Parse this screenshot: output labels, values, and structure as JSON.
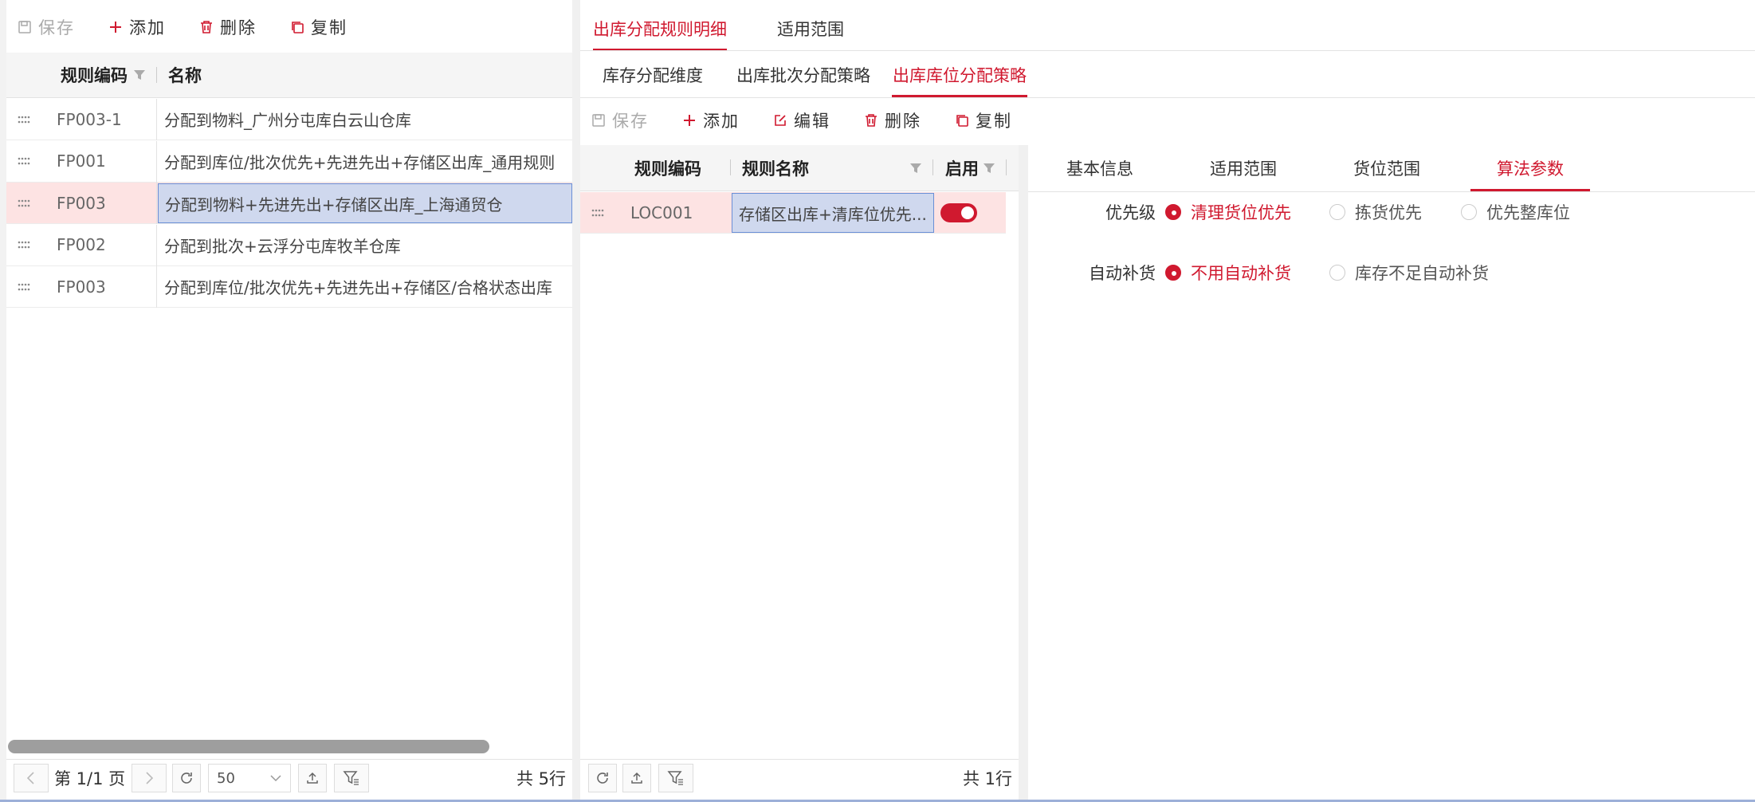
{
  "left": {
    "toolbar": {
      "save": "保存",
      "add": "添加",
      "delete": "删除",
      "copy": "复制"
    },
    "columns": {
      "code": "规则编码",
      "name": "名称"
    },
    "rows": [
      {
        "code": "FP003-1",
        "name": "分配到物料_广州分屯库白云山仓库"
      },
      {
        "code": "FP001",
        "name": "分配到库位/批次优先+先进先出+存储区出库_通用规则"
      },
      {
        "code": "FP003",
        "name": "分配到物料+先进先出+存储区出库_上海通贸仓"
      },
      {
        "code": "FP002",
        "name": "分配到批次+云浮分屯库牧羊仓库"
      },
      {
        "code": "FP003",
        "name": "分配到库位/批次优先+先进先出+存储区/合格状态出库"
      }
    ],
    "pager": {
      "page": "第 1/1 页",
      "size": "50",
      "total": "共 5行"
    }
  },
  "right": {
    "tabs": [
      "出库分配规则明细",
      "适用范围"
    ],
    "subtabs": [
      "库存分配维度",
      "出库批次分配策略",
      "出库库位分配策略"
    ],
    "toolbar": {
      "save": "保存",
      "add": "添加",
      "edit": "编辑",
      "delete": "删除",
      "copy": "复制"
    },
    "columns": {
      "code": "规则编码",
      "name": "规则名称",
      "enabled": "启用"
    },
    "rows": [
      {
        "code": "LOC001",
        "name": "存储区出库+清库位优先...",
        "enabled": true
      }
    ],
    "pager": {
      "total": "共 1行"
    },
    "detail_tabs": [
      "基本信息",
      "适用范围",
      "货位范围",
      "算法参数"
    ],
    "form": {
      "priority_label": "优先级",
      "priority_options": [
        "清理货位优先",
        "拣货优先",
        "优先整库位"
      ],
      "replenish_label": "自动补货",
      "replenish_options": [
        "不用自动补货",
        "库存不足自动补货"
      ]
    }
  },
  "colors": {
    "accent": "#d0192f",
    "selected_row": "#fde3e3",
    "selected_cell": "#cfd8ee"
  }
}
